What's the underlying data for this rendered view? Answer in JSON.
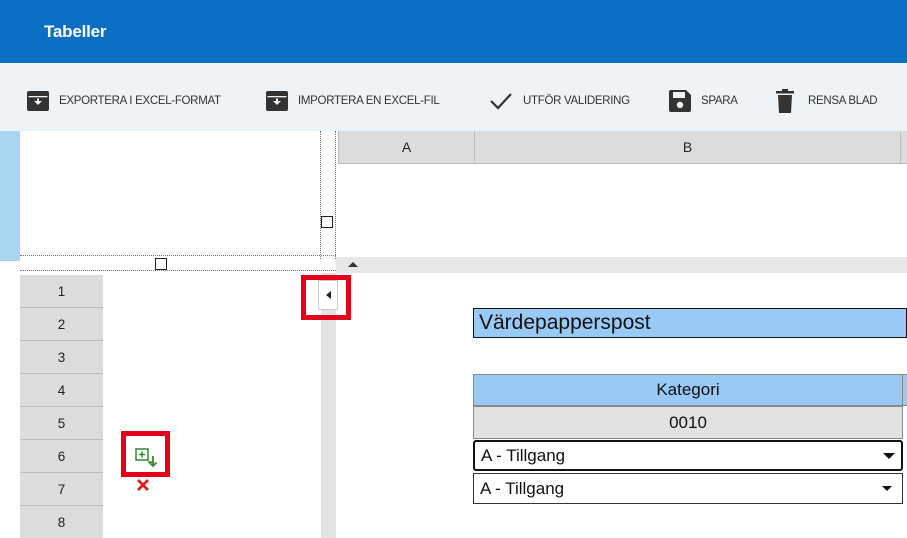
{
  "app": {
    "title": "Tabeller"
  },
  "toolbar": {
    "export_label": "EXPORTERA I EXCEL-FORMAT",
    "import_label": "IMPORTERA EN EXCEL-FIL",
    "validate_label": "UTFÖR VALIDERING",
    "save_label": "SPARA",
    "clear_label": "RENSA BLAD"
  },
  "sheet": {
    "columns": [
      "A",
      "B"
    ],
    "rows": [
      "1",
      "2",
      "3",
      "4",
      "5",
      "6",
      "7",
      "8"
    ],
    "heading": "Värdepapperspost",
    "category_header": "Kategori",
    "category_value": "0010",
    "dropdowns": [
      {
        "value": "A - Tillgang"
      },
      {
        "value": "A - Tillgang"
      }
    ]
  },
  "icons": {
    "add_row": "add-row-icon",
    "delete_row": "delete-row-icon",
    "collapse": "collapse-left-icon"
  },
  "colors": {
    "titlebar": "#0a6fc2",
    "highlight": "#e4001b",
    "header_blue": "#99c9f5"
  }
}
